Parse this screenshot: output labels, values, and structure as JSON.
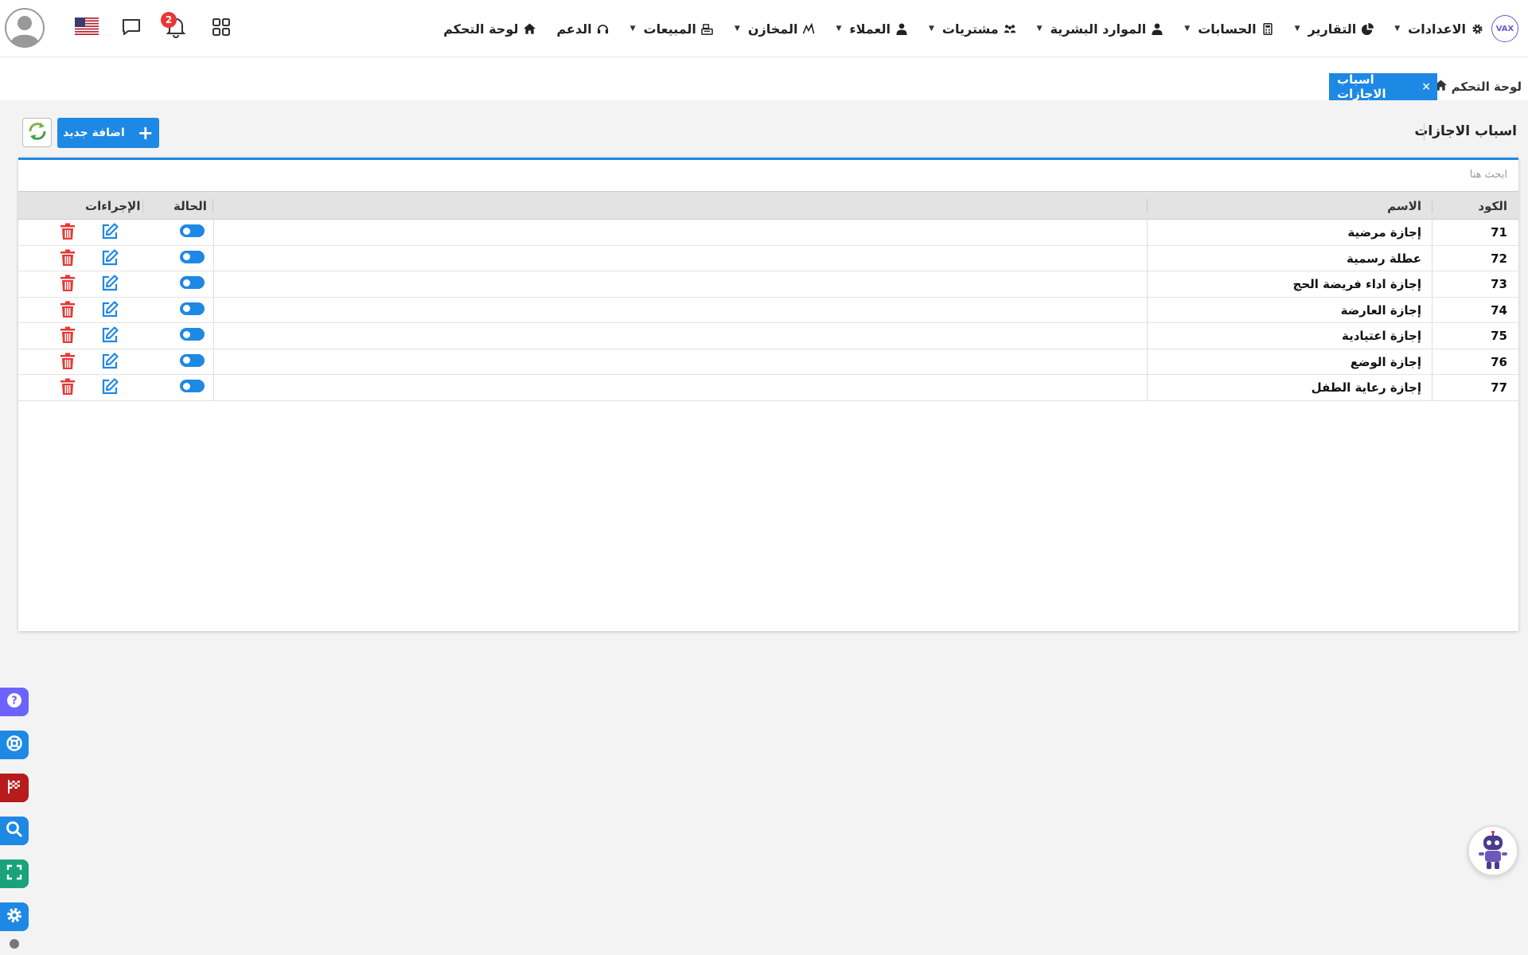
{
  "brand": {
    "logo_text": "VAX"
  },
  "nav": {
    "items": [
      {
        "label": "لوحة التحكم",
        "icon": "home-icon",
        "caret": false
      },
      {
        "label": "الدعم",
        "icon": "headset-icon",
        "caret": false
      },
      {
        "label": "المبيعات",
        "icon": "cash-register-icon",
        "caret": true
      },
      {
        "label": "المخازن",
        "icon": "warehouse-icon",
        "caret": true
      },
      {
        "label": "العملاء",
        "icon": "user-tie-icon",
        "caret": true
      },
      {
        "label": "مشتريات",
        "icon": "people-group-icon",
        "caret": true
      },
      {
        "label": "الموارد البشرية",
        "icon": "users-icon",
        "caret": true
      },
      {
        "label": "الحسابات",
        "icon": "calculator-icon",
        "caret": true
      },
      {
        "label": "التقارير",
        "icon": "pie-chart-icon",
        "caret": true
      },
      {
        "label": "الاعدادات",
        "icon": "gear-icon",
        "caret": true
      }
    ],
    "notifications_count": "2"
  },
  "breadcrumb": {
    "home_label": "لوحة التحكم",
    "active_tab_label": "اسباب الاجازات",
    "close_symbol": "×"
  },
  "page": {
    "title": "اسباب الاجازات",
    "add_button_label": "اضافة جديد",
    "search_placeholder": "ابحث هنا"
  },
  "table": {
    "headers": {
      "code": "الكود",
      "name": "الاسم",
      "status": "الحالة",
      "actions": "الإجراءات"
    },
    "rows": [
      {
        "code": "71",
        "name": "إجازة مرضية",
        "active": true
      },
      {
        "code": "72",
        "name": "عطلة رسمية",
        "active": true
      },
      {
        "code": "73",
        "name": "إجازة اداء فريضة الحج",
        "active": true
      },
      {
        "code": "74",
        "name": "إجازة العارضة",
        "active": true
      },
      {
        "code": "75",
        "name": "إجازة اعتيادية",
        "active": true
      },
      {
        "code": "76",
        "name": "إجازة الوضع",
        "active": true
      },
      {
        "code": "77",
        "name": "إجازة رعاية الطفل",
        "active": true
      }
    ]
  },
  "colors": {
    "primary": "#1e88e5",
    "danger": "#e53935",
    "float_help": "#6c63ff",
    "float_support": "#1e88e5",
    "float_flag": "#b71c1c",
    "float_search": "#1e88e5",
    "float_expand": "#1aa37a",
    "float_settings": "#1e88e5"
  }
}
